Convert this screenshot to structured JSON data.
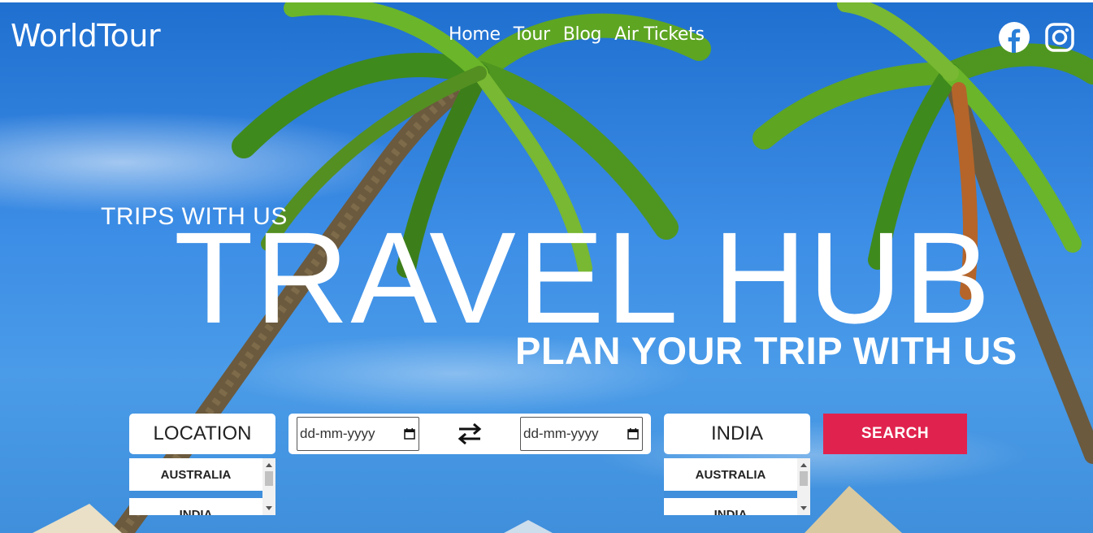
{
  "header": {
    "logo": "WorldTour",
    "nav": [
      "Home",
      "Tour",
      "Blog",
      "Air Tickets"
    ],
    "social_icons": [
      "facebook-icon",
      "instagram-icon"
    ]
  },
  "hero": {
    "kicker": "TRIPS WITH US",
    "headline": "TRAVEL HUB",
    "subheadline": "PLAN YOUR TRIP WITH US"
  },
  "search": {
    "from_label": "LOCATION",
    "to_label": "INDIA",
    "date_from_placeholder": "dd-mm-yyyy",
    "date_to_placeholder": "dd-mm-yyyy",
    "swap_icon": "swap-arrows-icon",
    "search_label": "SEARCH",
    "from_options": [
      "AUSTRALIA",
      "INDIA"
    ],
    "to_options": [
      "AUSTRALIA",
      "INDIA"
    ]
  },
  "colors": {
    "accent": "#e0234e",
    "sky": "#2a7fd8"
  }
}
